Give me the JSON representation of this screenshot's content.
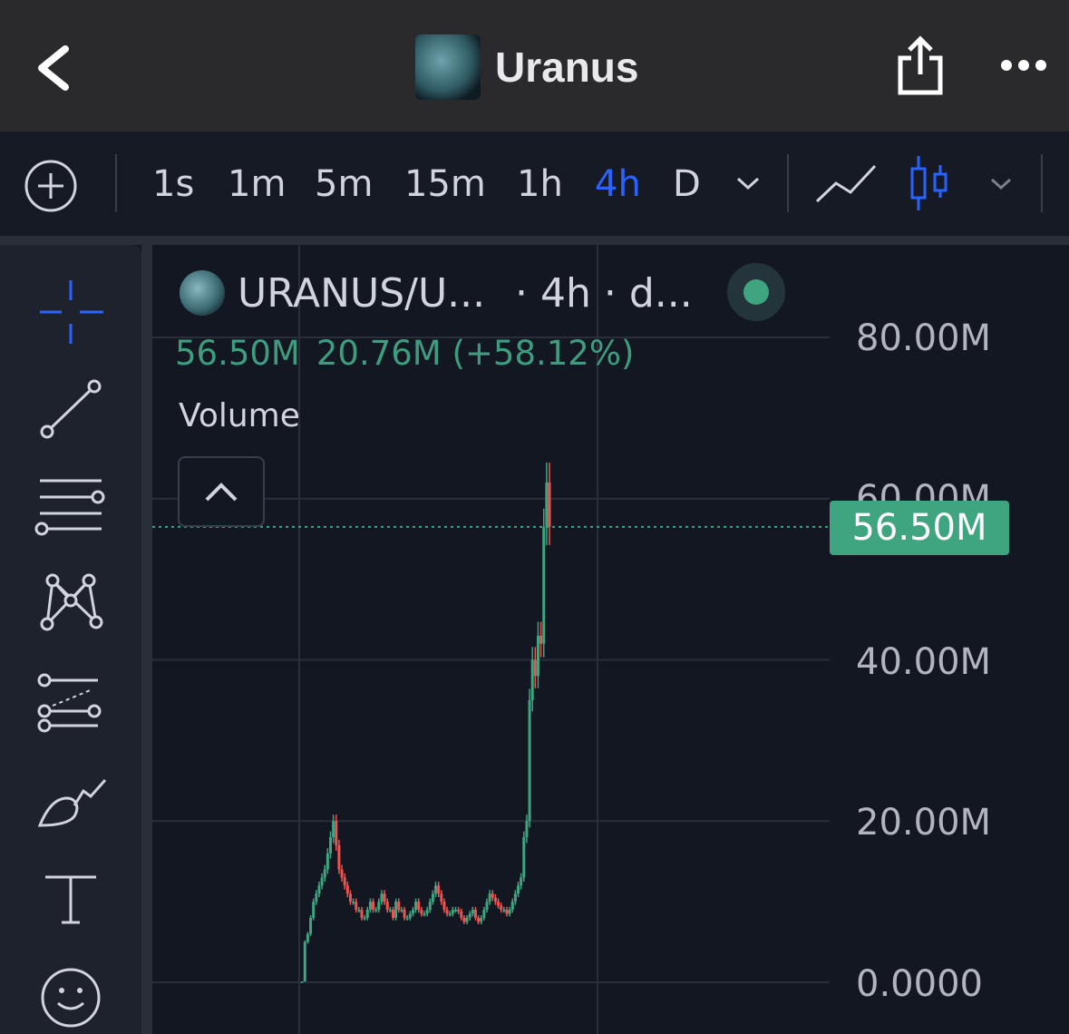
{
  "header": {
    "title": "Uranus",
    "back_icon": "chevron-left-icon",
    "share_icon": "share-icon",
    "more_icon": "more-horizontal-icon"
  },
  "toolbar": {
    "add_icon": "plus-circle-icon",
    "timeframes": [
      "1s",
      "1m",
      "5m",
      "15m",
      "1h",
      "4h",
      "D"
    ],
    "active_timeframe": "4h",
    "chart_type_line_icon": "line-chart-icon",
    "chart_type_candle_icon": "candlestick-icon",
    "accent_color": "#2962ff"
  },
  "drawing_tools": [
    "crosshair-icon",
    "trend-line-icon",
    "horizontal-lines-icon",
    "pattern-icon",
    "projection-icon",
    "brush-icon",
    "text-icon",
    "emoji-icon"
  ],
  "legend": {
    "symbol": "URANUS/U...",
    "interval": "· 4h · d...",
    "values": [
      "56.50M",
      "20.76M (+58.12%)"
    ],
    "volume_label": "Volume",
    "status_color": "#3fa580"
  },
  "price_tag": "56.50M",
  "chart_data": {
    "type": "line",
    "title": "",
    "xlabel": "",
    "ylabel": "",
    "y_ticks": [
      "80.00M",
      "60.00M",
      "40.00M",
      "20.00M",
      "0.0000"
    ],
    "ylim": [
      0,
      80000000
    ],
    "current_value": 56500000,
    "series": [
      {
        "values": [
          0,
          0.1,
          5,
          6,
          8,
          10,
          11,
          12,
          13,
          14,
          16,
          18,
          20,
          17,
          14,
          13,
          12,
          11,
          10,
          10,
          9,
          9,
          8,
          8,
          9,
          10,
          9,
          9,
          10,
          11,
          10,
          9,
          9,
          8,
          10,
          9,
          9,
          8,
          8,
          8.5,
          9,
          10,
          9,
          8.5,
          8.5,
          9,
          10,
          11,
          12,
          11,
          10,
          9,
          8.5,
          8.5,
          9,
          9,
          8.8,
          8,
          7.5,
          8,
          8.5,
          9,
          8,
          7.5,
          8,
          9,
          10,
          11,
          10.5,
          10,
          9.5,
          9,
          9,
          8.5,
          9,
          10,
          11,
          12,
          13,
          18,
          20,
          35,
          40,
          38,
          43,
          42,
          56.5,
          62,
          56.5
        ]
      }
    ],
    "color_up": "#3fa580",
    "color_down": "#ef5350",
    "grid": true
  }
}
